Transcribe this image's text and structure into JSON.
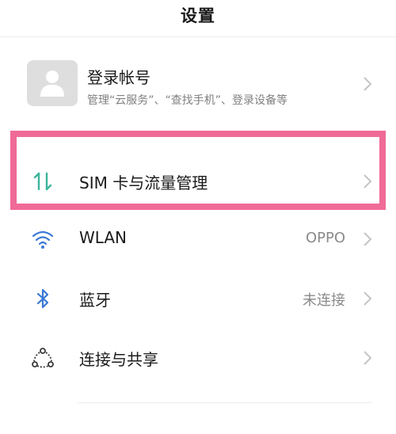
{
  "header": {
    "title": "设置"
  },
  "account": {
    "title": "登录帐号",
    "subtitle": "管理“云服务”、“查找手机”、登录设备等",
    "avatar_icon": "person-icon",
    "avatar_color": "#dedede"
  },
  "highlight": {
    "border_color": "#f06a98"
  },
  "rows": [
    {
      "id": "sim",
      "label": "SIM 卡与流量管理",
      "value": "",
      "icon": "data-arrows-icon",
      "icon_color": "#3bb59b"
    },
    {
      "id": "wlan",
      "label": "WLAN",
      "value": "OPPO",
      "icon": "wifi-icon",
      "icon_color": "#3a78d6"
    },
    {
      "id": "bluetooth",
      "label": "蓝牙",
      "value": "未连接",
      "icon": "bluetooth-icon",
      "icon_color": "#3a78d6"
    },
    {
      "id": "share",
      "label": "连接与共享",
      "value": "",
      "icon": "share-nodes-icon",
      "icon_color": "#3a3a3a"
    }
  ]
}
